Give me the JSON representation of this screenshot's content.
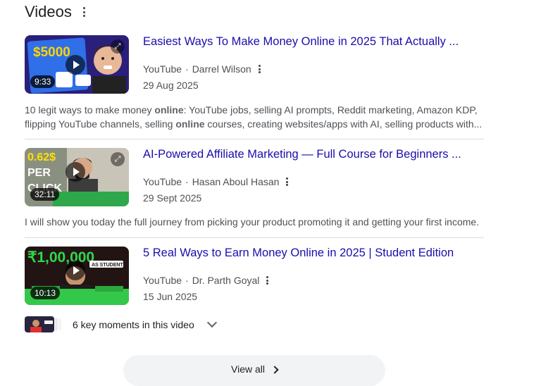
{
  "section": {
    "title": "Videos"
  },
  "videos": [
    {
      "title": "Easiest Ways To Make Money Online in 2025 That Actually ...",
      "source": "YouTube",
      "separator": "·",
      "channel": "Darrel Wilson",
      "date": "29 Aug 2025",
      "duration": "9:33",
      "thumb_text": "$5000",
      "snippet": {
        "p1": "10 legit ways to make money ",
        "b1": "online",
        "p2": ": YouTube jobs, selling AI prompts, Reddit marketing, Amazon KDP, flipping YouTube channels, selling ",
        "b2": "online",
        "p3": " courses, creating websites/apps with AI, selling products with..."
      }
    },
    {
      "title": "AI-Powered Affiliate Marketing — Full Course for Beginners ...",
      "source": "YouTube",
      "separator": "·",
      "channel": "Hasan Aboul Hasan",
      "date": "29 Sept 2025",
      "duration": "32:11",
      "thumb_text_1": "0.62$",
      "thumb_text_2": "PER",
      "thumb_text_3": "CLICK",
      "snippet": "I will show you today the full journey from picking your product promoting it and getting your first income."
    },
    {
      "title": "5 Real Ways to Earn Money Online in 2025 | Student Edition",
      "source": "YouTube",
      "separator": "·",
      "channel": "Dr. Parth Goyal",
      "date": "15 Jun 2025",
      "duration": "10:13",
      "thumb_text": "₹1,00,000",
      "thumb_badge": "AS STUDENT"
    }
  ],
  "key_moments": {
    "label": "6 key moments in this video"
  },
  "view_all": {
    "label": "View all"
  },
  "colors": {
    "link": "#1a0dab",
    "meta": "#4d5156",
    "divider": "#dadce0",
    "button_bg": "#f1f3f4"
  }
}
